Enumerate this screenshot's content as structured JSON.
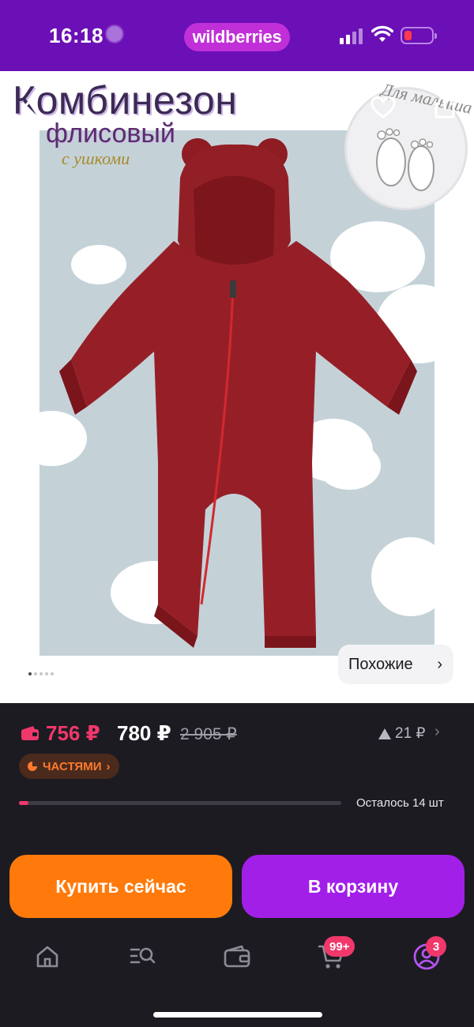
{
  "status_bar": {
    "time": "16:18",
    "brand": "wildberries",
    "battery_level": 0.15,
    "colors": {
      "background": "#6b0fb6",
      "brand_pill": "#c02fd8",
      "battery_low": "#ff3b4b"
    }
  },
  "product": {
    "image_title_line1": "Комбинезон",
    "image_title_line2": "флисовый",
    "image_title_line3": "с ушкоми",
    "image_brand_badge": "Для малыша",
    "similar_label": "Похожие",
    "gallery_total": 5,
    "gallery_active": 1
  },
  "price": {
    "wallet_price": "756 ₽",
    "price": "780 ₽",
    "old_price": "2 905 ₽",
    "price_change": "21 ₽",
    "installments_label": "ЧАСТЯМИ",
    "stock_text": "Осталось 14 шт",
    "stock_fraction": 0.03,
    "colors": {
      "wallet": "#f0386b",
      "installments_text": "#ff7a2e"
    }
  },
  "actions": {
    "buy_now": "Купить сейчас",
    "add_to_cart": "В корзину",
    "colors": {
      "buy_now": "#ff7a0a",
      "add_to_cart": "#a21fe8"
    }
  },
  "tabbar": {
    "items": [
      {
        "icon": "home-icon"
      },
      {
        "icon": "catalog-search-icon"
      },
      {
        "icon": "wallet-icon"
      },
      {
        "icon": "cart-icon",
        "badge": "99+"
      },
      {
        "icon": "profile-icon",
        "badge": "3"
      }
    ]
  }
}
